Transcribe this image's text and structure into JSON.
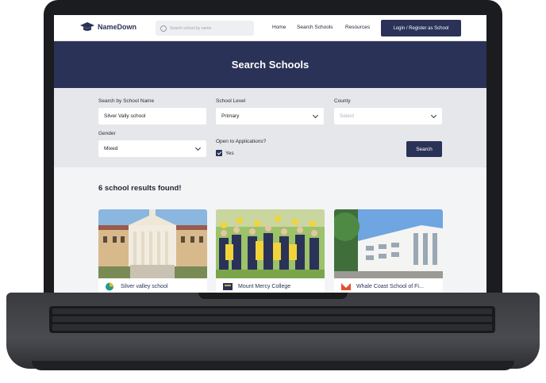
{
  "nav": {
    "brand": "NameDown",
    "search_placeholder": "Search school by name",
    "links": [
      "Home",
      "Search Schools",
      "Resources"
    ],
    "login_label": "Login / Register as School"
  },
  "banner": {
    "title": "Search Schools"
  },
  "filters": {
    "name_label": "Search by School Name",
    "name_value": "Silver Vally school",
    "level_label": "School Level",
    "level_value": "Primary",
    "county_label": "County",
    "county_placeholder": "Select",
    "gender_label": "Gender",
    "gender_value": "Mixed",
    "open_label": "Open to Applications?",
    "open_option": "Yes",
    "open_checked": true,
    "search_button": "Search"
  },
  "results": {
    "summary": "6 school results found!",
    "cards": [
      {
        "name": "Silver valley school",
        "logo_color": "#1f9d8a"
      },
      {
        "name": "Mount Mercy College",
        "logo_color": "#2b3257"
      },
      {
        "name": "Whale Coast School of Fi...",
        "logo_color": "#e0522b"
      }
    ]
  },
  "colors": {
    "primary": "#2b3257",
    "banner": "#2b3257",
    "filter_bg": "#e6e7eb"
  }
}
